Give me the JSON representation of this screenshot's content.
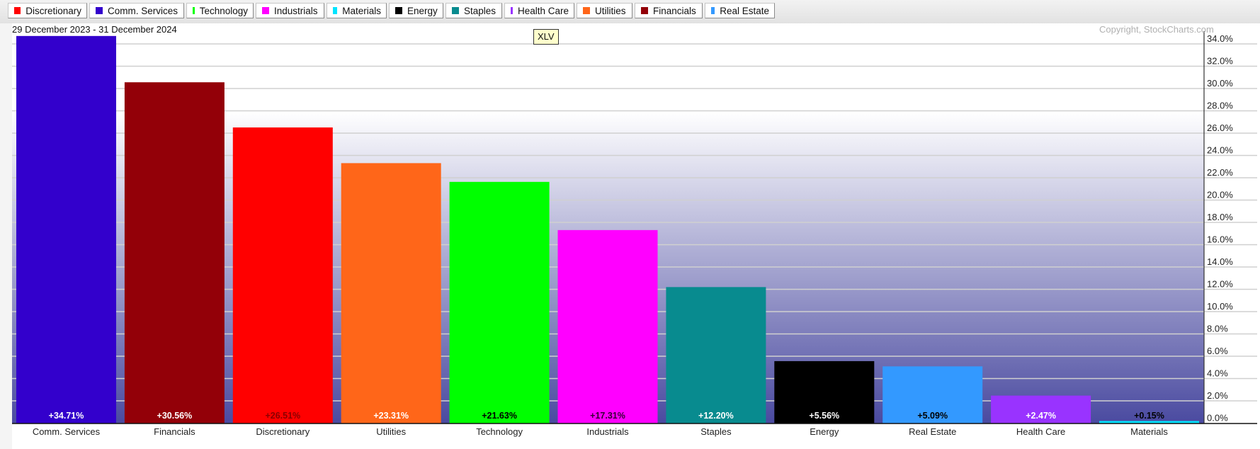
{
  "legend": [
    {
      "label": "Discretionary",
      "color": "#ff0000"
    },
    {
      "label": "Comm. Services",
      "color": "#3300cc"
    },
    {
      "label": "Technology",
      "color": "#00ff00"
    },
    {
      "label": "Industrials",
      "color": "#ff00ff"
    },
    {
      "label": "Materials",
      "color": "#00e5ff"
    },
    {
      "label": "Energy",
      "color": "#000000"
    },
    {
      "label": "Staples",
      "color": "#088b8f"
    },
    {
      "label": "Health Care",
      "color": "#9933ff"
    },
    {
      "label": "Utilities",
      "color": "#ff6619"
    },
    {
      "label": "Financials",
      "color": "#930008"
    },
    {
      "label": "Real Estate",
      "color": "#3399ff"
    }
  ],
  "date_range": "29 December 2023 - 31 December 2024",
  "copyright": "Copyright, StockCharts.com",
  "tooltip": "XLV",
  "chart_data": {
    "type": "bar",
    "title": "",
    "subtitle": "29 December 2023 - 31 December 2024",
    "xlabel": "",
    "ylabel": "",
    "ylim": [
      0,
      34
    ],
    "y_ticks": [
      0,
      2,
      4,
      6,
      8,
      10,
      12,
      14,
      16,
      18,
      20,
      22,
      24,
      26,
      28,
      30,
      32,
      34
    ],
    "y_tick_labels": [
      "0.0%",
      "2.0%",
      "4.0%",
      "6.0%",
      "8.0%",
      "10.0%",
      "12.0%",
      "14.0%",
      "16.0%",
      "18.0%",
      "20.0%",
      "22.0%",
      "24.0%",
      "26.0%",
      "28.0%",
      "30.0%",
      "32.0%",
      "34.0%"
    ],
    "y_axis_position": "right",
    "grid": true,
    "legend_position": "top",
    "categories": [
      "Comm. Services",
      "Financials",
      "Discretionary",
      "Utilities",
      "Technology",
      "Industrials",
      "Staples",
      "Energy",
      "Real Estate",
      "Health Care",
      "Materials"
    ],
    "values": [
      34.71,
      30.56,
      26.51,
      23.31,
      21.63,
      17.31,
      12.2,
      5.56,
      5.09,
      2.47,
      0.15
    ],
    "data_labels": [
      "+34.71%",
      "+30.56%",
      "+26.51%",
      "+23.31%",
      "+21.63%",
      "+17.31%",
      "+12.20%",
      "+5.56%",
      "+5.09%",
      "+2.47%",
      "+0.15%"
    ],
    "colors": [
      "#3300cc",
      "#930008",
      "#ff0000",
      "#ff6619",
      "#00ff00",
      "#ff00ff",
      "#088b8f",
      "#000000",
      "#3399ff",
      "#9933ff",
      "#00e5ff"
    ],
    "label_colors": [
      "#ffffff",
      "#ffffff",
      "#8a0000",
      "#ffffff",
      "#000000",
      "#330033",
      "#ffffff",
      "#ffffff",
      "#000000",
      "#ffffff",
      "#000000"
    ]
  }
}
